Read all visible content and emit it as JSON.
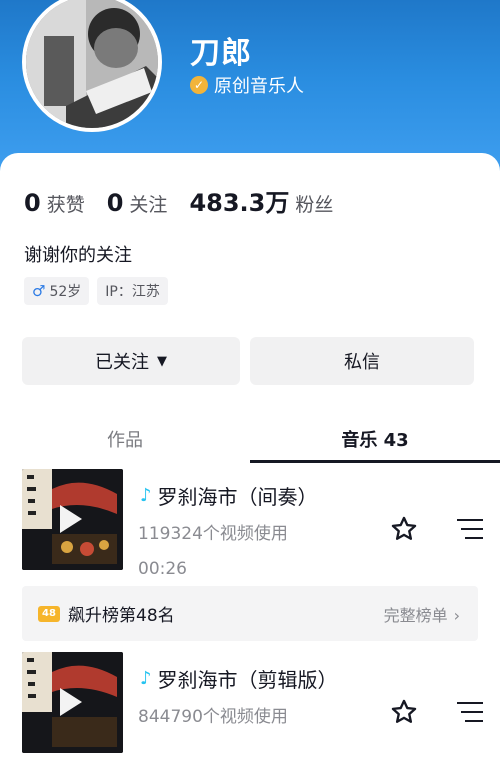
{
  "profile": {
    "name": "刀郎",
    "verified_label": "原创音乐人",
    "stats": [
      {
        "value": "0",
        "label": "获赞"
      },
      {
        "value": "0",
        "label": "关注"
      },
      {
        "value": "483.3万",
        "label": "粉丝"
      }
    ],
    "bio": "谢谢你的关注",
    "tags": {
      "age": "52岁",
      "ip": "IP：江苏"
    }
  },
  "actions": {
    "follow_label": "已关注",
    "message_label": "私信"
  },
  "tabs": {
    "works": "作品",
    "music": "音乐 43",
    "active": "music"
  },
  "tracks": [
    {
      "title": "罗刹海市（间奏）",
      "usage": "119324个视频使用",
      "duration": "00:26"
    },
    {
      "title": "罗刹海市（剪辑版）",
      "usage": "844790个视频使用",
      "duration": ""
    }
  ],
  "chart": {
    "badge": "48",
    "text": "飙升榜第48名",
    "link": "完整榜单"
  },
  "colors": {
    "header": "#2a8de0",
    "verify": "#f2b43a",
    "note": "#25c3f0",
    "badge": "#f6b52b"
  },
  "icons": [
    "verified-icon",
    "male-icon",
    "caret-down-icon",
    "play-icon",
    "music-note-icon",
    "star-icon",
    "menu-icon",
    "chevron-right-icon"
  ]
}
